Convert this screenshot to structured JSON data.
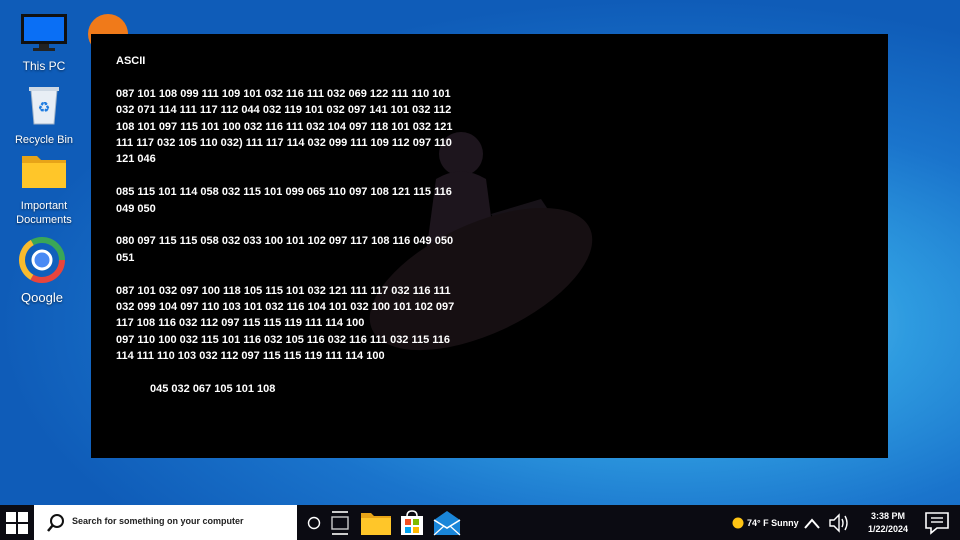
{
  "desktop": {
    "icons": [
      {
        "label": "This PC"
      },
      {
        "label": "Recycle Bin"
      },
      {
        "label": "Important Documents"
      },
      {
        "label": "Qoogle"
      }
    ]
  },
  "terminal": {
    "heading": "ASCII",
    "blocks": [
      "087 101 108 099 111 109 101 032 116 111 032 069 122 111 110 101 032 071 114 111 117 112 044 032 119 101 032 097 141 101 032 112 108 101 097 115 101 100 032 116 111 032 104 097 118 101 032 121 111 117 032 105 110 032) 111 117 114 032 099 111 109 112 097 110 121 046",
      "085 115 101 114 058 032 115 101 099 065 110 097 108 121 115 116 049 050",
      "080 097 115 115 058 032 033 100 101 102 097 117 108 116 049 050 051",
      "087 101 032 097 100 118 105 115 101 032 121 111 117 032 116 111 032 099 104 097 110 103 101 032 116 104 101 032 100 101 102 097 117 108 116 032 112 097 115 115 119 111 114 100",
      "097 110 100 032 115 101 116 032 105 116 032 116 111 032 115 116 114 111 110 103 032 112 097 115 115 119 111 114 100"
    ],
    "signature": "045 032 067 105 101 108"
  },
  "taskbar": {
    "search_placeholder": "Search for something on your computer",
    "weather": "74° F Sunny",
    "time": "3:38 PM",
    "date": "1/22/2024"
  },
  "colors": {
    "terminal_bg": "#000000",
    "taskbar_bg": "#0b0b12",
    "desktop_accent": "#1a74cc"
  }
}
